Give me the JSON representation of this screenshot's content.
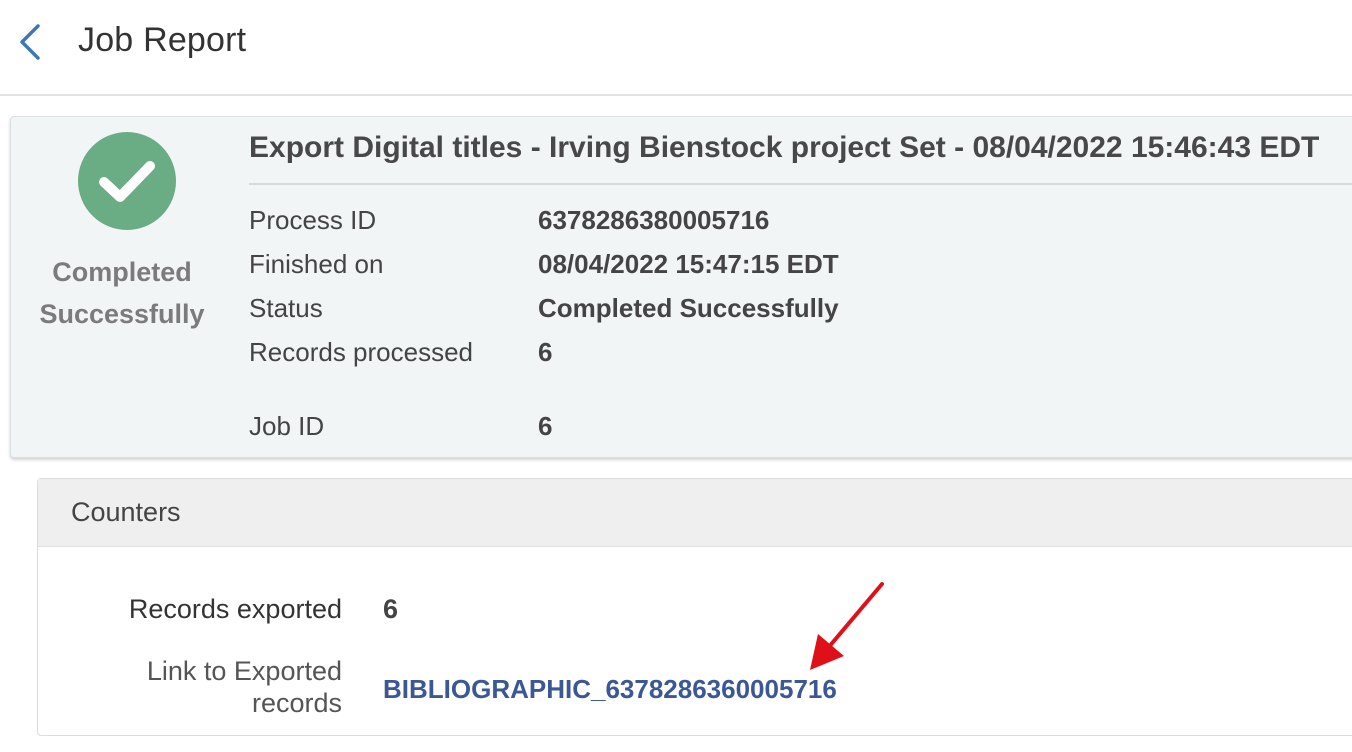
{
  "header": {
    "title": "Job Report",
    "back_icon": "chevron-left-icon"
  },
  "summary": {
    "status_icon": "check-circle-icon",
    "status_color": "#6aac84",
    "status_caption_line1": "Completed",
    "status_caption_line2": "Successfully",
    "job_title": "Export Digital titles - Irving Bienstock project Set - 08/04/2022 15:46:43 EDT",
    "fields": [
      {
        "label": "Process ID",
        "value": "6378286380005716"
      },
      {
        "label": "Finished on",
        "value": "08/04/2022 15:47:15 EDT"
      },
      {
        "label": "Status",
        "value": "Completed Successfully"
      },
      {
        "label": "Records processed",
        "value": "6"
      },
      {
        "label": "Job ID",
        "value": "6"
      }
    ]
  },
  "counters": {
    "title": "Counters",
    "records_exported_label": "Records exported",
    "records_exported_value": "6",
    "link_label_line1": "Link to Exported",
    "link_label_line2": "records",
    "link_text": "BIBLIOGRAPHIC_6378286360005716",
    "link_color": "#3b5795"
  },
  "annotation": {
    "arrow_icon": "red-arrow-icon",
    "arrow_color": "#e0101a"
  }
}
